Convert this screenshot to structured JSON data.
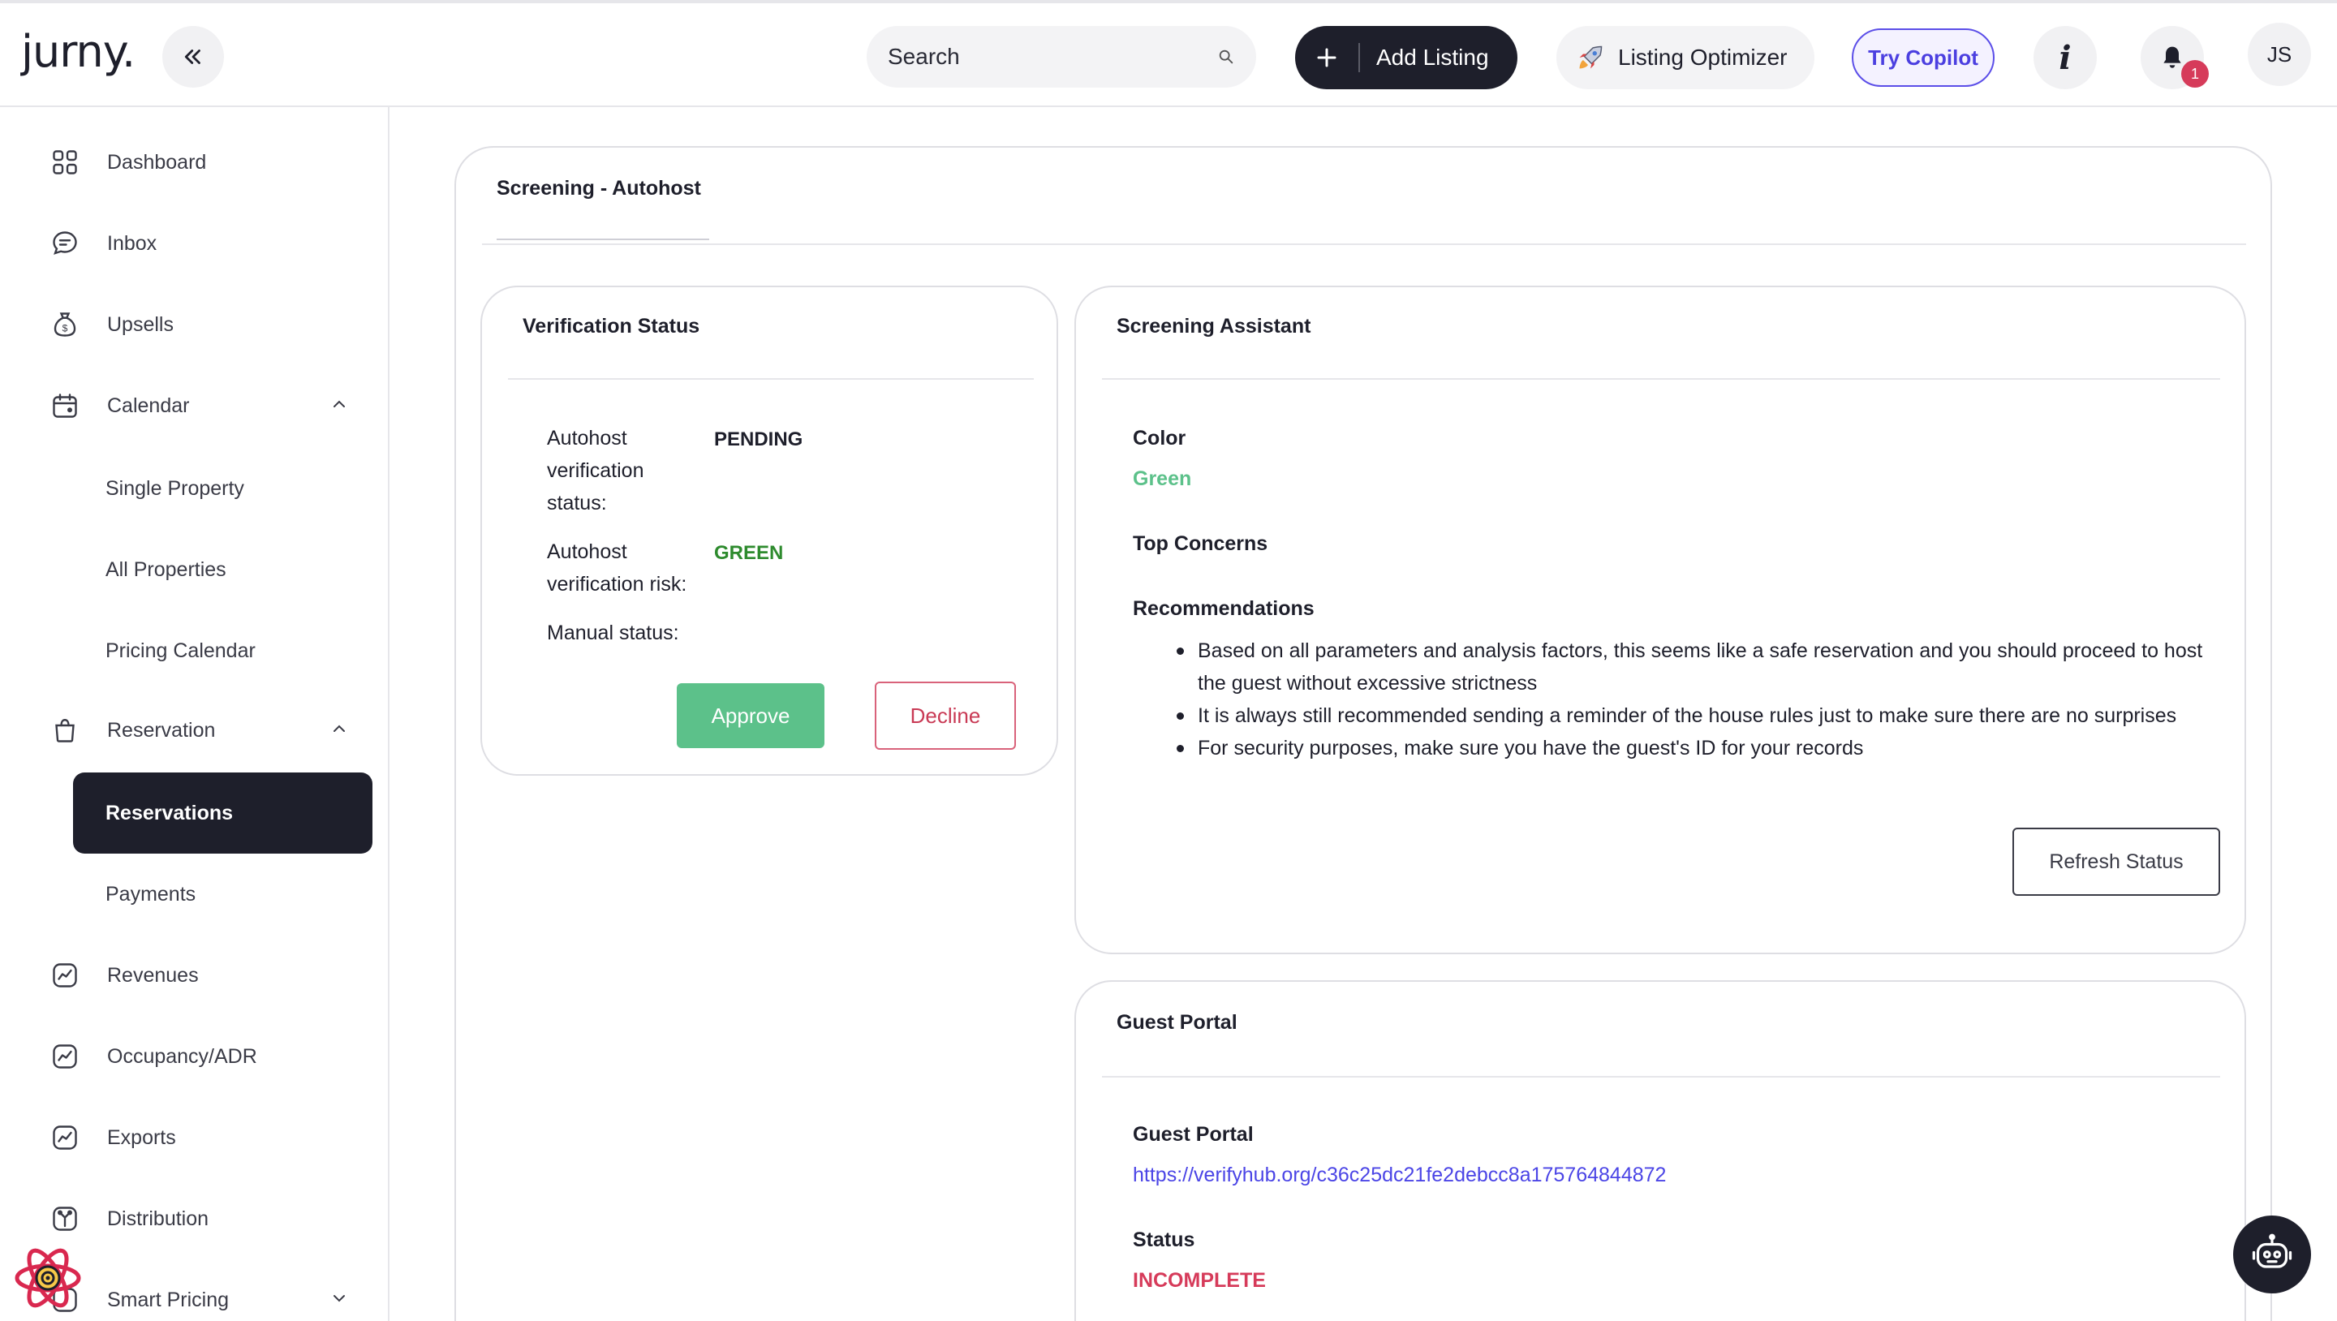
{
  "header": {
    "logo_text": "jurny.",
    "search_placeholder": "Search",
    "add_listing_label": "Add Listing",
    "listing_optimizer_label": "Listing Optimizer",
    "try_copilot_label": "Try Copilot",
    "info_label": "i",
    "notification_count": "1",
    "avatar_initials": "JS"
  },
  "sidebar": {
    "items": {
      "dashboard": "Dashboard",
      "inbox": "Inbox",
      "upsells": "Upsells",
      "calendar": "Calendar",
      "single_property": "Single Property",
      "all_properties": "All Properties",
      "pricing_calendar": "Pricing Calendar",
      "reservation": "Reservation",
      "reservations": "Reservations",
      "payments": "Payments",
      "revenues": "Revenues",
      "occupancy": "Occupancy/ADR",
      "exports": "Exports",
      "distribution": "Distribution",
      "smart_pricing": "Smart Pricing"
    }
  },
  "main": {
    "title": "Screening - Autohost",
    "verification": {
      "title": "Verification Status",
      "status_label_1": "Autohost",
      "status_label_2": "verification",
      "status_label_3": "status:",
      "status_value": "PENDING",
      "risk_label_1": "Autohost",
      "risk_label_2": "verification risk:",
      "risk_value": "GREEN",
      "manual_label": "Manual status:",
      "approve_label": "Approve",
      "decline_label": "Decline"
    },
    "assistant": {
      "title": "Screening Assistant",
      "color_label": "Color",
      "color_value": "Green",
      "concerns_label": "Top Concerns",
      "recommendations_label": "Recommendations",
      "recommendations": [
        "Based on all parameters and analysis factors, this seems like a safe reservation and you should proceed to host the guest without excessive strictness",
        "It is always still recommended sending a reminder of the house rules just to make sure there are no surprises",
        "For security purposes, make sure you have the guest's ID for your records"
      ],
      "refresh_label": "Refresh Status"
    },
    "guest_portal": {
      "title": "Guest Portal",
      "portal_label": "Guest Portal",
      "portal_url": "https://verifyhub.org/c36c25dc21fe2debcc8a175764844872",
      "status_label": "Status",
      "status_value": "INCOMPLETE"
    }
  },
  "colors": {
    "dark": "#1e1f2b",
    "approve_green": "#5cc18a",
    "risk_green": "#2e8b2e",
    "color_green": "#5cc18a",
    "decline_red": "#c93a55",
    "incomplete_red": "#d63b5a",
    "link_purple": "#4b45e6",
    "copilot_purple": "#5b4ee8"
  }
}
